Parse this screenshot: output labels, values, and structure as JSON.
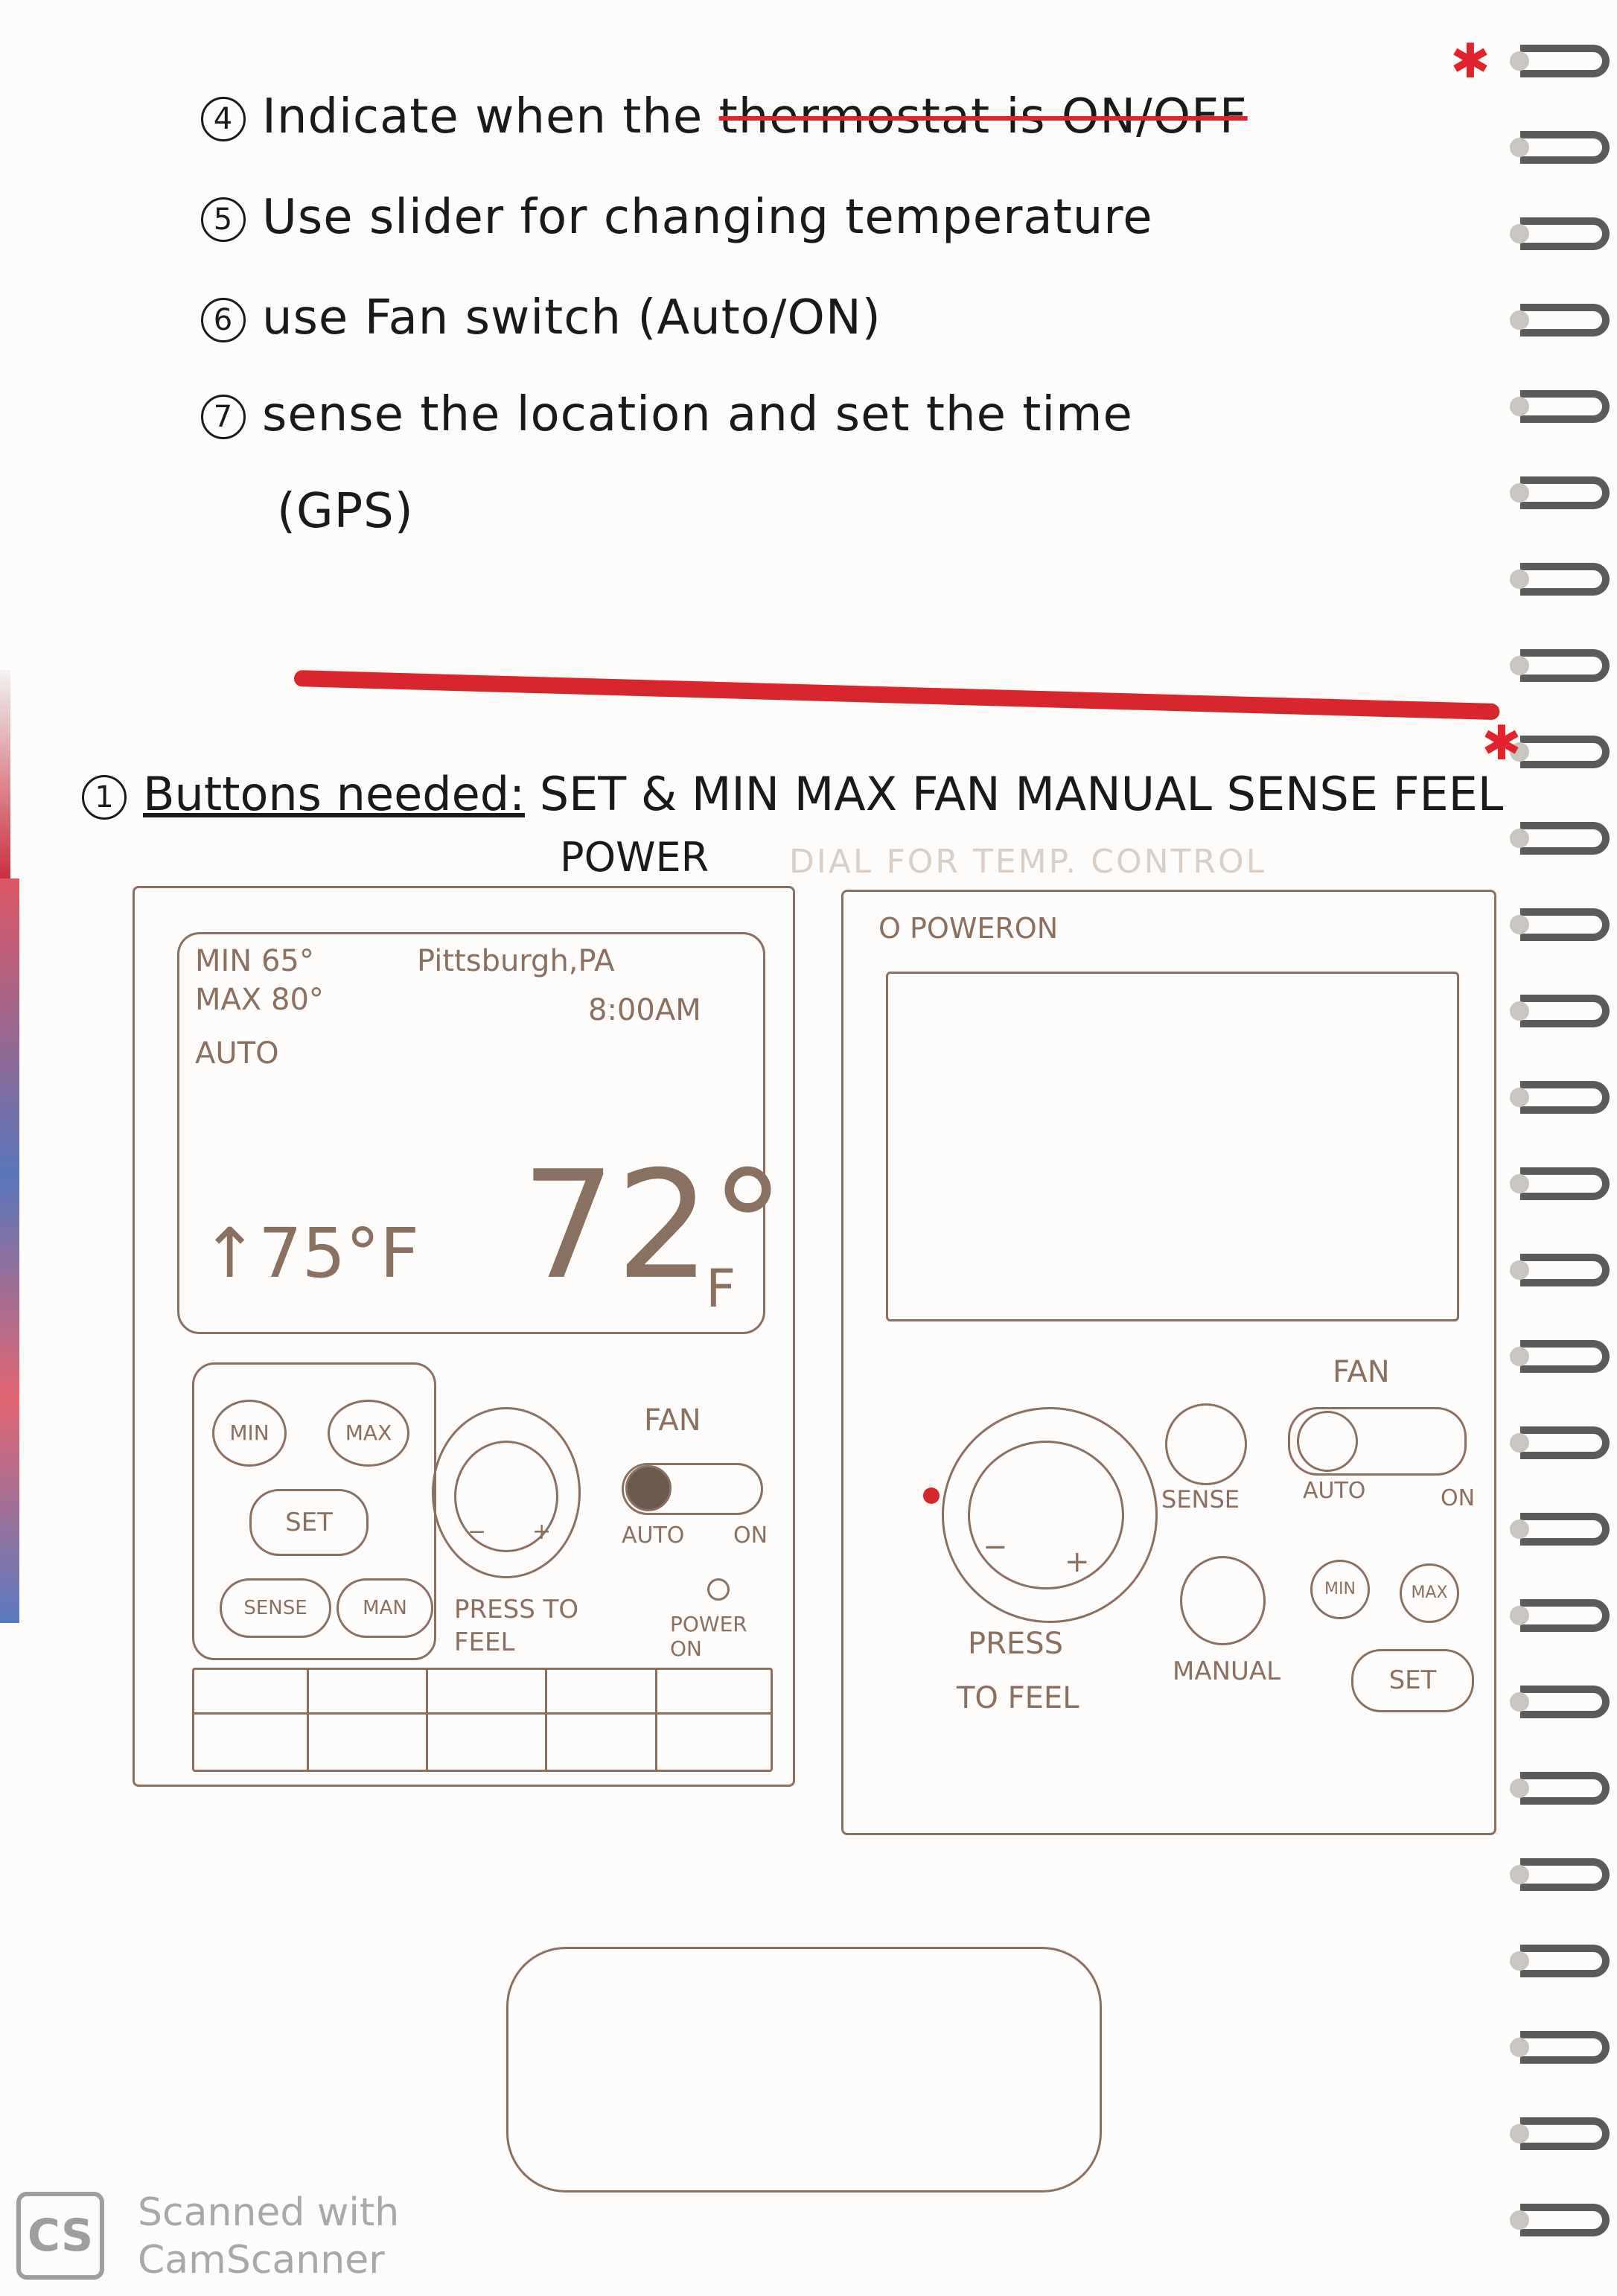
{
  "notes": [
    {
      "num": "4",
      "text": "Indicate when the ",
      "struck": "thermostat is ON/OFF"
    },
    {
      "num": "5",
      "text": "Use slider for changing temperature"
    },
    {
      "num": "6",
      "text": "use Fan switch (Auto/ON)"
    },
    {
      "num": "7",
      "text": "sense the location and set the time"
    },
    {
      "num": "",
      "text": "(GPS)"
    }
  ],
  "buttons_needed": {
    "num": "1",
    "label": "Buttons needed:",
    "items": "SET & MIN MAX FAN MANUAL SENSE FEEL",
    "power": "POWER",
    "dial_note": "DIAL FOR TEMP. CONTROL"
  },
  "sketch_left": {
    "min": "MIN 65°",
    "max": "MAX 80°",
    "mode": "AUTO",
    "location": "Pittsburgh,PA",
    "time": "8:00AM",
    "set_temp": "↑75°F",
    "current_temp": "72°",
    "current_unit": "F",
    "btn_min": "MIN",
    "btn_max": "MAX",
    "btn_set": "SET",
    "btn_sense": "SENSE",
    "btn_man": "MAN",
    "fan_label": "FAN",
    "fan_auto": "AUTO",
    "fan_on": "ON",
    "press_to_feel": "PRESS TO FEEL",
    "power_on": "POWER ON"
  },
  "sketch_right": {
    "power": "O POWERON",
    "fan_label": "FAN",
    "sense": "SENSE",
    "fan_auto": "AUTO",
    "fan_on": "ON",
    "btn_min": "MIN",
    "btn_max": "MAX",
    "manual": "MANUAL",
    "set": "SET",
    "press": "PRESS",
    "to_feel": "TO FEEL"
  },
  "watermark": {
    "logo": "CS",
    "line1": "Scanned with",
    "line2": "CamScanner"
  },
  "colors": {
    "ink": "#1a1a1a",
    "pencil": "#8a7060",
    "red_marker": "#d8262d",
    "paper": "#fdfcfa"
  }
}
